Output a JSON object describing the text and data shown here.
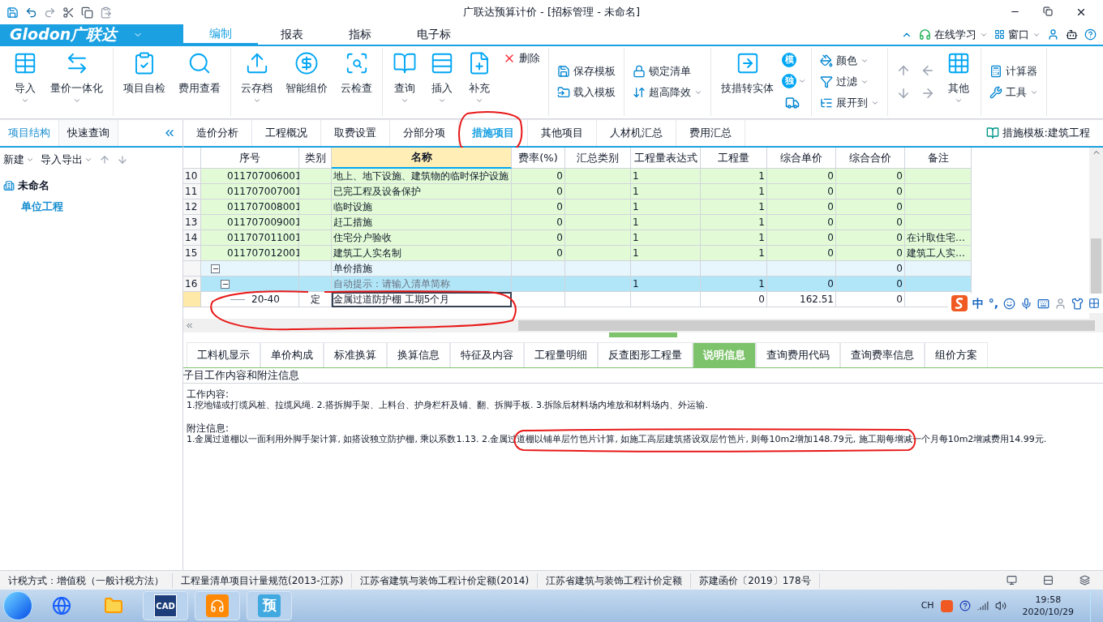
{
  "title_bar": {
    "title": "广联达预算计价 - [招标管理 - 未命名]"
  },
  "logo": {
    "text": "Glodon广联达"
  },
  "menu_tabs": [
    {
      "label": "编制",
      "selected": true
    },
    {
      "label": "报表",
      "selected": false
    },
    {
      "label": "指标",
      "selected": false
    },
    {
      "label": "电子标",
      "selected": false
    }
  ],
  "top_right": {
    "learn": "在线学习",
    "window": "窗口"
  },
  "ribbon": [
    [
      [
        {
          "label": "导入",
          "kind": "large",
          "dropdown": true
        }
      ],
      [
        {
          "label": "量价一体化",
          "kind": "large",
          "dropdown": true
        }
      ]
    ],
    [
      [
        {
          "label": "项目自检",
          "kind": "large",
          "dropdown": false
        }
      ],
      [
        {
          "label": "费用查看",
          "kind": "large",
          "dropdown": false
        }
      ]
    ],
    [
      [
        {
          "label": "云存档",
          "kind": "large",
          "dropdown": true
        }
      ],
      [
        {
          "label": "智能组价",
          "kind": "large",
          "dropdown": false
        }
      ],
      [
        {
          "label": "云检查",
          "kind": "large",
          "dropdown": false
        }
      ]
    ],
    [
      [
        {
          "label": "查询",
          "kind": "large",
          "dropdown": true
        }
      ],
      [
        {
          "label": "插入",
          "kind": "large",
          "dropdown": true
        }
      ],
      [
        {
          "label": "补充",
          "kind": "large",
          "dropdown": true
        }
      ],
      [
        {
          "label": "删除",
          "kind": "small",
          "dropdown": false
        }
      ]
    ],
    [
      [
        {
          "label": "保存模板",
          "kind": "small",
          "dropdown": false
        },
        {
          "label": "载入模板",
          "kind": "small",
          "dropdown": false
        }
      ]
    ],
    [
      [
        {
          "label": "锁定清单",
          "kind": "small",
          "dropdown": false
        },
        {
          "label": "超高降效",
          "kind": "small",
          "dropdown": true
        }
      ]
    ],
    [
      [
        {
          "label": "技措转实体",
          "kind": "large",
          "dropdown": false
        }
      ],
      [
        {
          "label": "模",
          "kind": "glyph",
          "dropdown": false
        },
        {
          "label": "独",
          "kind": "glyph",
          "dropdown": true
        },
        {
          "kind": "iconsmall",
          "dropdown": false
        }
      ]
    ],
    [
      [
        {
          "label": "颜色",
          "kind": "small",
          "dropdown": true
        },
        {
          "label": "过滤",
          "kind": "small",
          "dropdown": true
        },
        {
          "label": "展开到",
          "kind": "small",
          "dropdown": true
        }
      ]
    ],
    [
      [
        {
          "kind": "iconsmall",
          "dropdown": false
        },
        {
          "kind": "iconsmall",
          "dropdown": false
        }
      ],
      [
        {
          "kind": "iconsmall",
          "dropdown": false
        },
        {
          "kind": "iconsmall",
          "dropdown": false
        }
      ],
      [
        {
          "label": "其他",
          "kind": "large",
          "dropdown": true
        }
      ]
    ],
    [
      [
        {
          "label": "计算器",
          "kind": "small",
          "dropdown": false
        },
        {
          "label": "工具",
          "kind": "small",
          "dropdown": true
        }
      ]
    ]
  ],
  "left_panel": {
    "tabs": [
      {
        "label": "项目结构",
        "selected": true
      },
      {
        "label": "快速查询",
        "selected": false
      }
    ],
    "toolbar": [
      {
        "label": "新建",
        "dropdown": true
      },
      {
        "label": "导入导出",
        "dropdown": true
      }
    ],
    "tree": [
      {
        "label": "未命名",
        "selected": false,
        "children": [
          {
            "label": "单位工程",
            "selected": true
          }
        ]
      }
    ]
  },
  "view_tabs": [
    {
      "label": "造价分析",
      "selected": false
    },
    {
      "label": "工程概况",
      "selected": false
    },
    {
      "label": "取费设置",
      "selected": false
    },
    {
      "label": "分部分项",
      "selected": false
    },
    {
      "label": "措施项目",
      "selected": true
    },
    {
      "label": "其他项目",
      "selected": false
    },
    {
      "label": "人材机汇总",
      "selected": false
    },
    {
      "label": "费用汇总",
      "selected": false
    }
  ],
  "template_label": "措施模板:建筑工程",
  "table": {
    "columns": [
      "序号",
      "类别",
      "名称",
      "费率(%)",
      "汇总类别",
      "工程量表达式",
      "工程量",
      "综合单价",
      "综合合价",
      "备注"
    ],
    "rows": [
      {
        "kind": "item",
        "number": "10",
        "code": "011707006001",
        "type": "",
        "name": "地上、地下设施、建筑物的临时保护设施",
        "rate": "0",
        "summary": "",
        "expr": "1",
        "qty": "1",
        "unit_price": "0",
        "total": "0",
        "note": ""
      },
      {
        "kind": "item",
        "number": "11",
        "code": "011707007001",
        "type": "",
        "name": "已完工程及设备保护",
        "rate": "0",
        "summary": "",
        "expr": "1",
        "qty": "1",
        "unit_price": "0",
        "total": "0",
        "note": ""
      },
      {
        "kind": "item",
        "number": "12",
        "code": "011707008001",
        "type": "",
        "name": "临时设施",
        "rate": "0",
        "summary": "",
        "expr": "1",
        "qty": "1",
        "unit_price": "0",
        "total": "0",
        "note": ""
      },
      {
        "kind": "item",
        "number": "13",
        "code": "011707009001",
        "type": "",
        "name": "赶工措施",
        "rate": "0",
        "summary": "",
        "expr": "1",
        "qty": "1",
        "unit_price": "0",
        "total": "0",
        "note": ""
      },
      {
        "kind": "item",
        "number": "14",
        "code": "011707011001",
        "type": "",
        "name": "住宅分户验收",
        "rate": "0",
        "summary": "",
        "expr": "1",
        "qty": "1",
        "unit_price": "0",
        "total": "0",
        "note": "在计取住宅…"
      },
      {
        "kind": "item",
        "number": "15",
        "code": "011707012001",
        "type": "",
        "name": "建筑工人实名制",
        "rate": "0",
        "summary": "",
        "expr": "1",
        "qty": "1",
        "unit_price": "0",
        "total": "0",
        "note": "建筑工人实…"
      },
      {
        "kind": "group",
        "number": "",
        "code": "",
        "type": "",
        "name": "单价措施",
        "rate": "",
        "summary": "",
        "expr": "",
        "qty": "",
        "unit_price": "",
        "total": "0",
        "note": ""
      },
      {
        "kind": "current",
        "number": "16",
        "code": "",
        "type": "",
        "name": "自动提示：请输入清单简称",
        "rate": "",
        "summary": "",
        "expr": "1",
        "qty": "1",
        "unit_price": "0",
        "total": "0",
        "note": ""
      },
      {
        "kind": "quota",
        "number": "",
        "code": "20-40",
        "type": "定",
        "name": "金属过道防护棚 工期5个月",
        "rate": "",
        "summary": "",
        "expr": "",
        "qty": "0",
        "unit_price": "162.51",
        "total": "0",
        "note": ""
      }
    ]
  },
  "ime_bar": {
    "items": [
      "中",
      "°,"
    ]
  },
  "bottom_tabs": [
    {
      "label": "工料机显示",
      "selected": false
    },
    {
      "label": "单价构成",
      "selected": false
    },
    {
      "label": "标准换算",
      "selected": false
    },
    {
      "label": "换算信息",
      "selected": false
    },
    {
      "label": "特征及内容",
      "selected": false
    },
    {
      "label": "工程量明细",
      "selected": false
    },
    {
      "label": "反查图形工程量",
      "selected": false
    },
    {
      "label": "说明信息",
      "selected": true
    },
    {
      "label": "查询费用代码",
      "selected": false
    },
    {
      "label": "查询费率信息",
      "selected": false
    },
    {
      "label": "组价方案",
      "selected": false
    }
  ],
  "info": {
    "heading": "子目工作内容和附注信息",
    "paragraphs": [
      {
        "title": "工作内容:",
        "text": "1.挖地锚或打缆风桩、拉缆风绳. 2.搭拆脚手架、上料台、护身栏杆及铺、翻、拆脚手板. 3.拆除后材料场内堆放和材料场内、外运输."
      },
      {
        "title": "附注信息:",
        "text": "1.金属过道棚以一面利用外脚手架计算, 如搭设独立防护棚, 乘以系数1.13. 2.金属过道棚以铺单层竹笆片计算, 如施工高层建筑搭设双层竹笆片, 则每10m2增加148.79元, 施工期每增减一个月每10m2增减费用14.99元."
      }
    ]
  },
  "status_bar": [
    "计税方式：增值税（一般计税方法）",
    "工程量清单项目计量规范(2013-江苏)",
    "江苏省建筑与装饰工程计价定额(2014)",
    "江苏省建筑与装饰工程计价定额",
    "苏建函价〔2019〕178号"
  ],
  "taskbar": {
    "apps": [
      {
        "kind": "ie"
      },
      {
        "kind": "folder"
      },
      {
        "kind": "cad",
        "label": "CAD"
      },
      {
        "kind": "glodon"
      },
      {
        "kind": "budget",
        "label": "预"
      }
    ],
    "lang": "CH",
    "time": "19:58",
    "date": "2020/10/29"
  }
}
